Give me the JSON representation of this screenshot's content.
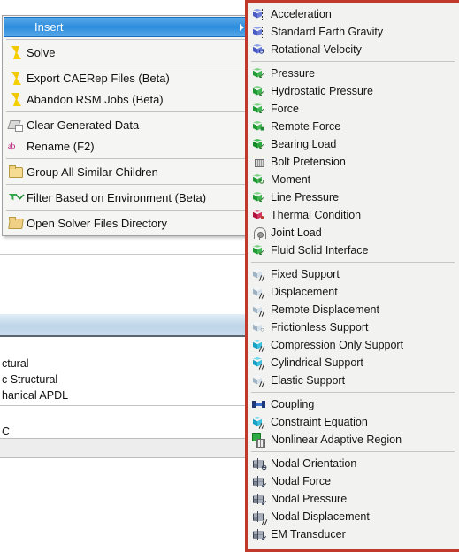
{
  "background_panel": {
    "rows": [
      {
        "text": "",
        "style": "white"
      },
      {
        "text": "",
        "style": "blueband"
      },
      {
        "text": "ctural",
        "style": "plain"
      },
      {
        "text": "c Structural",
        "style": "plain"
      },
      {
        "text": "hanical APDL",
        "style": "plain"
      },
      {
        "text": "",
        "style": "plain"
      },
      {
        "text": "C",
        "style": "plain"
      },
      {
        "text": "",
        "style": "grey"
      }
    ]
  },
  "context_menu": {
    "groups": [
      {
        "items": [
          {
            "label": "Insert",
            "icon": "none-icon",
            "selected": true,
            "has_submenu": true
          }
        ]
      },
      {
        "items": [
          {
            "label": "Solve",
            "icon": "lightning-bolt-icon",
            "selected": false,
            "has_submenu": false
          }
        ]
      },
      {
        "items": [
          {
            "label": "Export CAERep Files (Beta)",
            "icon": "lightning-bolt-icon",
            "selected": false,
            "has_submenu": false
          },
          {
            "label": "Abandon RSM Jobs (Beta)",
            "icon": "lightning-bolt-icon",
            "selected": false,
            "has_submenu": false
          }
        ]
      },
      {
        "items": [
          {
            "label": "Clear Generated Data",
            "icon": "eraser-icon",
            "selected": false,
            "has_submenu": false
          },
          {
            "label": "Rename (F2)",
            "icon": "rename-ab-icon",
            "selected": false,
            "has_submenu": false
          }
        ]
      },
      {
        "items": [
          {
            "label": "Group All Similar Children",
            "icon": "folder-icon",
            "selected": false,
            "has_submenu": false
          }
        ]
      },
      {
        "items": [
          {
            "label": "Filter Based on Environment (Beta)",
            "icon": "filter-icon",
            "selected": false,
            "has_submenu": false
          }
        ]
      },
      {
        "items": [
          {
            "label": "Open Solver Files Directory",
            "icon": "folder-open-icon",
            "selected": false,
            "has_submenu": false
          }
        ]
      }
    ]
  },
  "submenu": {
    "border_color": "#c0392b",
    "groups": [
      {
        "name": "inertial-loads",
        "items": [
          {
            "label": "Acceleration",
            "icon": "blue-cube-acceleration-icon"
          },
          {
            "label": "Standard Earth Gravity",
            "icon": "blue-cube-gravity-icon"
          },
          {
            "label": "Rotational Velocity",
            "icon": "blue-cube-rotational-velocity-icon"
          }
        ]
      },
      {
        "name": "structural-loads",
        "items": [
          {
            "label": "Pressure",
            "icon": "green-cube-pressure-icon"
          },
          {
            "label": "Hydrostatic Pressure",
            "icon": "green-cube-hydrostatic-pressure-icon"
          },
          {
            "label": "Force",
            "icon": "green-cube-force-icon"
          },
          {
            "label": "Remote Force",
            "icon": "green-cube-remote-force-icon"
          },
          {
            "label": "Bearing Load",
            "icon": "green-solid-bearing-load-icon"
          },
          {
            "label": "Bolt Pretension",
            "icon": "bolt-pretension-icon"
          },
          {
            "label": "Moment",
            "icon": "green-cube-moment-icon"
          },
          {
            "label": "Line Pressure",
            "icon": "green-cube-line-pressure-icon"
          },
          {
            "label": "Thermal Condition",
            "icon": "red-cube-thermal-condition-icon"
          },
          {
            "label": "Joint Load",
            "icon": "joint-load-icon"
          },
          {
            "label": "Fluid Solid Interface",
            "icon": "green-cube-fluid-solid-interface-icon"
          }
        ]
      },
      {
        "name": "supports",
        "items": [
          {
            "label": "Fixed Support",
            "icon": "white-cube-fixed-support-icon"
          },
          {
            "label": "Displacement",
            "icon": "white-cube-displacement-icon"
          },
          {
            "label": "Remote Displacement",
            "icon": "white-cube-remote-displacement-icon"
          },
          {
            "label": "Frictionless Support",
            "icon": "white-cube-frictionless-support-icon"
          },
          {
            "label": "Compression Only Support",
            "icon": "cyan-cube-compression-only-support-icon"
          },
          {
            "label": "Cylindrical Support",
            "icon": "cyan-cube-cylindrical-support-icon"
          },
          {
            "label": "Elastic Support",
            "icon": "white-cube-elastic-support-icon"
          }
        ]
      },
      {
        "name": "conditions",
        "items": [
          {
            "label": "Coupling",
            "icon": "coupling-icon"
          },
          {
            "label": "Constraint Equation",
            "icon": "cyan-cube-constraint-equation-icon"
          },
          {
            "label": "Nonlinear Adaptive Region",
            "icon": "nonlinear-adaptive-region-icon"
          }
        ]
      },
      {
        "name": "direct-fe",
        "items": [
          {
            "label": "Nodal Orientation",
            "icon": "wire-cube-nodal-orientation-icon"
          },
          {
            "label": "Nodal Force",
            "icon": "wire-cube-nodal-force-icon"
          },
          {
            "label": "Nodal Pressure",
            "icon": "wire-cube-nodal-pressure-icon"
          },
          {
            "label": "Nodal Displacement",
            "icon": "wire-cube-nodal-displacement-icon"
          },
          {
            "label": "EM Transducer",
            "icon": "wire-cube-em-transducer-icon"
          }
        ]
      }
    ]
  }
}
